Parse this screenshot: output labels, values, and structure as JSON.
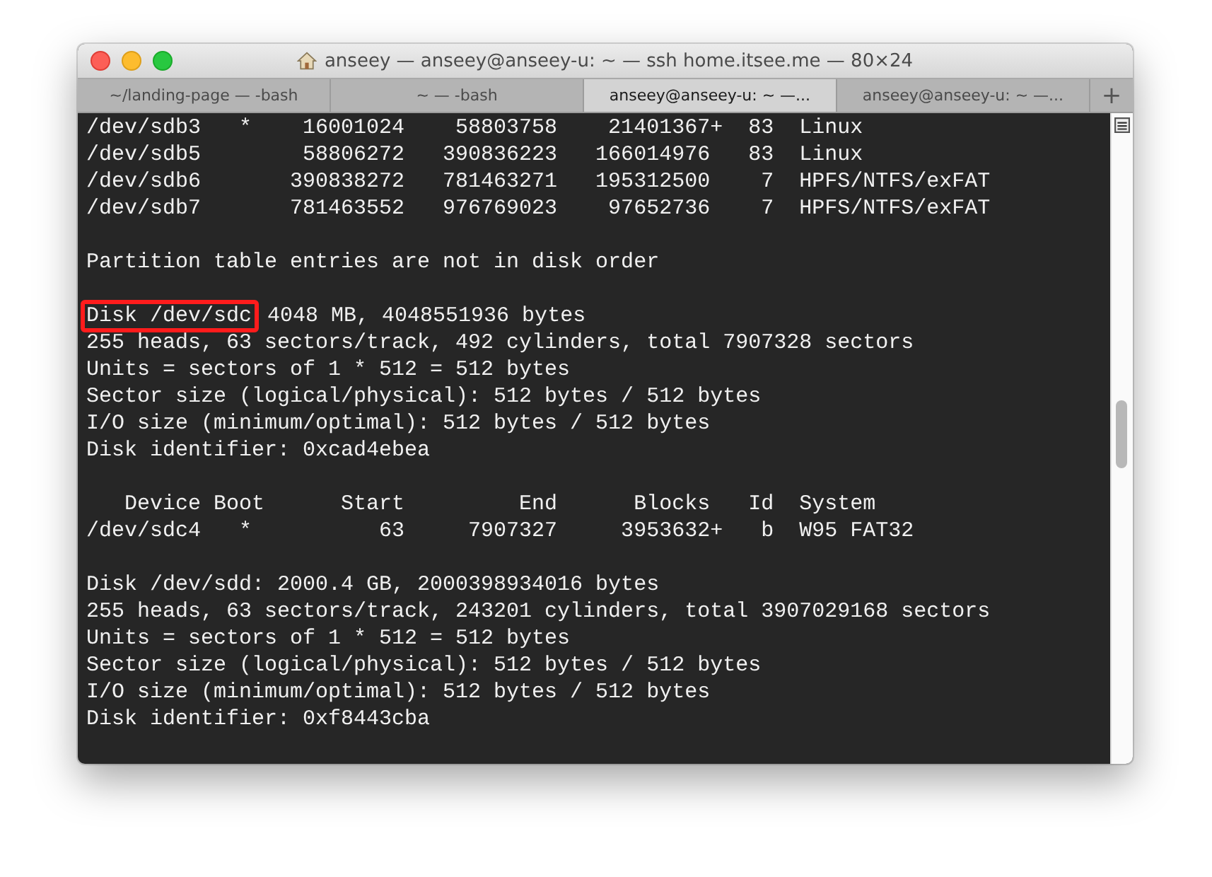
{
  "window": {
    "title": "anseey — anseey@anseey-u: ~ — ssh home.itsee.me — 80×24"
  },
  "tabs": [
    {
      "label": "~/landing-page — -bash",
      "selected": false
    },
    {
      "label": "~ — -bash",
      "selected": false
    },
    {
      "label": "anseey@anseey-u: ~ —...",
      "selected": true
    },
    {
      "label": "anseey@anseey-u: ~ —...",
      "selected": false
    }
  ],
  "new_tab_button": "+",
  "terminal": {
    "lines": [
      {
        "kind": "text",
        "text": "/dev/sdb3   *    16001024    58803758    21401367+  83  Linux"
      },
      {
        "kind": "text",
        "text": "/dev/sdb5        58806272   390836223   166014976   83  Linux"
      },
      {
        "kind": "text",
        "text": "/dev/sdb6       390838272   781463271   195312500    7  HPFS/NTFS/exFAT"
      },
      {
        "kind": "text",
        "text": "/dev/sdb7       781463552   976769023    97652736    7  HPFS/NTFS/exFAT"
      },
      {
        "kind": "blank"
      },
      {
        "kind": "text",
        "text": "Partition table entries are not in disk order"
      },
      {
        "kind": "blank"
      },
      {
        "kind": "highlight",
        "highlighted": "Disk /dev/sdc",
        "text": "4048 MB, 4048551936 bytes"
      },
      {
        "kind": "text",
        "text": "255 heads, 63 sectors/track, 492 cylinders, total 7907328 sectors"
      },
      {
        "kind": "text",
        "text": "Units = sectors of 1 * 512 = 512 bytes"
      },
      {
        "kind": "text",
        "text": "Sector size (logical/physical): 512 bytes / 512 bytes"
      },
      {
        "kind": "text",
        "text": "I/O size (minimum/optimal): 512 bytes / 512 bytes"
      },
      {
        "kind": "text",
        "text": "Disk identifier: 0xcad4ebea"
      },
      {
        "kind": "blank"
      },
      {
        "kind": "text",
        "text": "   Device Boot      Start         End      Blocks   Id  System"
      },
      {
        "kind": "text",
        "text": "/dev/sdc4   *          63     7907327     3953632+   b  W95 FAT32"
      },
      {
        "kind": "blank"
      },
      {
        "kind": "text",
        "text": "Disk /dev/sdd: 2000.4 GB, 2000398934016 bytes"
      },
      {
        "kind": "text",
        "text": "255 heads, 63 sectors/track, 243201 cylinders, total 3907029168 sectors"
      },
      {
        "kind": "text",
        "text": "Units = sectors of 1 * 512 = 512 bytes"
      },
      {
        "kind": "text",
        "text": "Sector size (logical/physical): 512 bytes / 512 bytes"
      },
      {
        "kind": "text",
        "text": "I/O size (minimum/optimal): 512 bytes / 512 bytes"
      },
      {
        "kind": "text",
        "text": "Disk identifier: 0xf8443cba"
      }
    ]
  }
}
